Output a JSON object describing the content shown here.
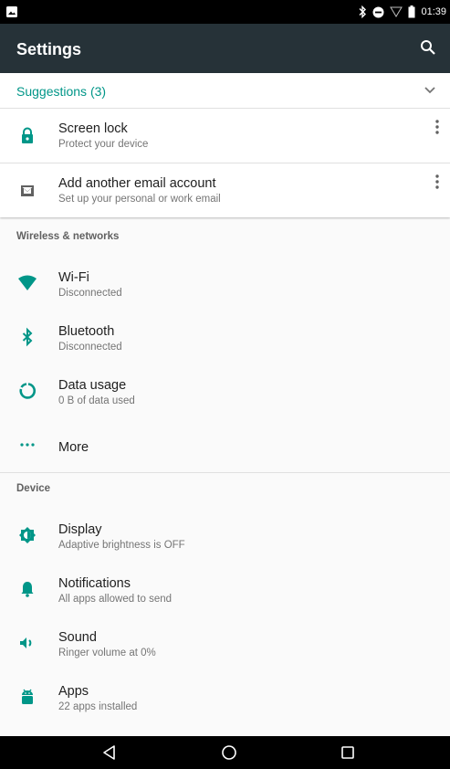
{
  "status_bar": {
    "time": "01:39"
  },
  "app_bar": {
    "title": "Settings"
  },
  "suggestions": {
    "header": "Suggestions (3)",
    "items": [
      {
        "title": "Screen lock",
        "subtitle": "Protect your device",
        "icon": "lock-icon"
      },
      {
        "title": "Add another email account",
        "subtitle": "Set up your personal or work email",
        "icon": "email-icon"
      }
    ]
  },
  "sections": [
    {
      "header": "Wireless & networks",
      "items": [
        {
          "title": "Wi-Fi",
          "subtitle": "Disconnected",
          "icon": "wifi-icon"
        },
        {
          "title": "Bluetooth",
          "subtitle": "Disconnected",
          "icon": "bluetooth-icon"
        },
        {
          "title": "Data usage",
          "subtitle": "0 B of data used",
          "icon": "data-usage-icon"
        },
        {
          "title": "More",
          "subtitle": "",
          "icon": "more-horiz-icon"
        }
      ]
    },
    {
      "header": "Device",
      "items": [
        {
          "title": "Display",
          "subtitle": "Adaptive brightness is OFF",
          "icon": "brightness-icon"
        },
        {
          "title": "Notifications",
          "subtitle": "All apps allowed to send",
          "icon": "bell-icon"
        },
        {
          "title": "Sound",
          "subtitle": "Ringer volume at 0%",
          "icon": "volume-icon"
        },
        {
          "title": "Apps",
          "subtitle": "22 apps installed",
          "icon": "android-icon"
        }
      ]
    }
  ],
  "colors": {
    "accent": "#009688",
    "app_bar": "#263238",
    "status_bar": "#000000",
    "nav_bar": "#000000"
  }
}
